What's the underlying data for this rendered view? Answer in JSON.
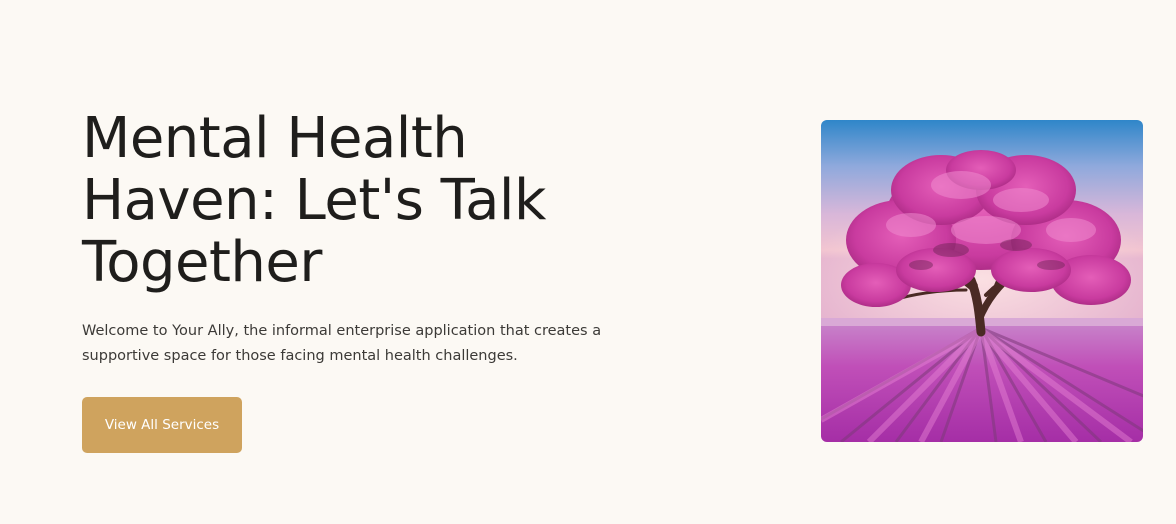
{
  "hero": {
    "title": "Mental Health Haven: Let's Talk Together",
    "description": "Welcome to Your Ally, the informal enterprise application that creates a supportive space for those facing mental health challenges.",
    "cta_label": "View All Services",
    "image_alt": "Pink blossoming tree in a lavender field"
  },
  "colors": {
    "background": "#fcf9f4",
    "text": "#1f1e1c",
    "accent": "#cfa35e"
  }
}
